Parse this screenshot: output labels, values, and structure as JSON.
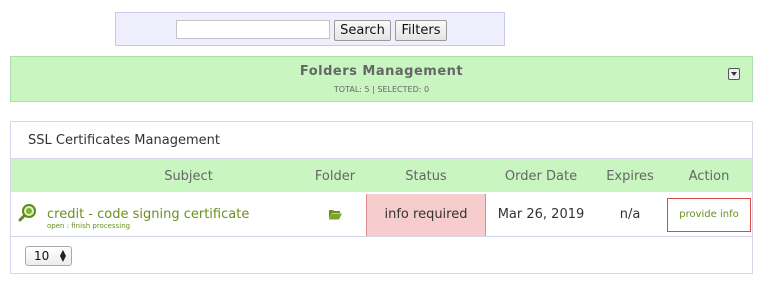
{
  "search": {
    "value": "",
    "placeholder": "",
    "search_label": "Search",
    "filters_label": "Filters"
  },
  "folders": {
    "title": "Folders Management",
    "summary": "TOTAL: 5 | SELECTED: 0",
    "collapse_icon": "chevron-down-icon"
  },
  "ssl": {
    "title": "SSL Certificates Management",
    "columns": [
      "Subject",
      "Folder",
      "Status",
      "Order Date",
      "Expires",
      "Action"
    ],
    "rows": [
      {
        "subject": "credit - code signing certificate",
        "subject_sub": "open : finish processing",
        "folder_icon": "folder-open-icon",
        "status": "info required",
        "order_date": "Mar 26, 2019",
        "expires": "n/a",
        "action": "provide info"
      }
    ],
    "page_size": "10"
  },
  "colors": {
    "accent_green": "#c9f5c1",
    "link_green": "#6b8f21",
    "status_bg": "#f7cccc",
    "status_border": "#e08a8a",
    "panel_bg": "#eeeefc"
  }
}
